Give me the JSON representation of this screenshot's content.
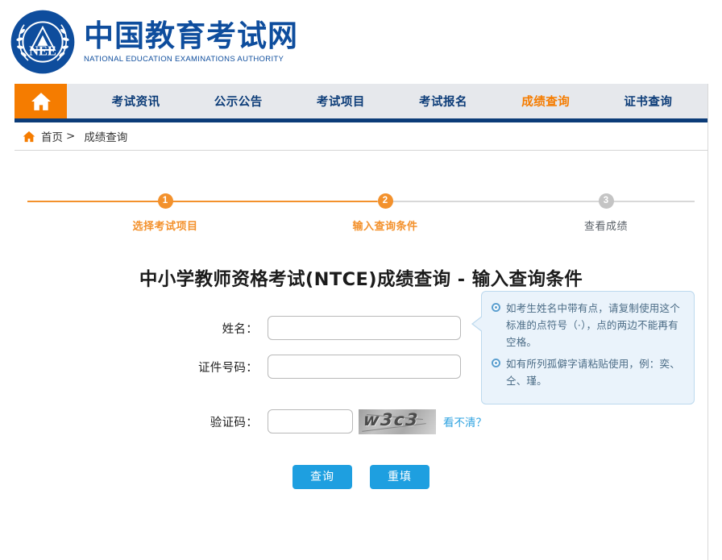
{
  "site": {
    "logo_cn": "中国教育考试网",
    "logo_en": "NATIONAL EDUCATION EXAMINATIONS AUTHORITY",
    "logo_initials": "NEE",
    "brand_blue": "#0e4d9d",
    "accent_orange": "#f57c00",
    "nav_bar_blue": "#0c3c78"
  },
  "nav": {
    "home_icon": "home-icon",
    "items": [
      {
        "label": "考试资讯",
        "active": false
      },
      {
        "label": "公示公告",
        "active": false
      },
      {
        "label": "考试项目",
        "active": false
      },
      {
        "label": "考试报名",
        "active": false
      },
      {
        "label": "成绩查询",
        "active": true
      },
      {
        "label": "证书查询",
        "active": false
      }
    ]
  },
  "breadcrumb": {
    "icon": "home-icon",
    "home": "首页",
    "separator": ">",
    "current": "成绩查询"
  },
  "steps": [
    {
      "number": "1",
      "label": "选择考试项目",
      "state": "done"
    },
    {
      "number": "2",
      "label": "输入查询条件",
      "state": "active"
    },
    {
      "number": "3",
      "label": "查看成绩",
      "state": "pending"
    }
  ],
  "form": {
    "title": "中小学教师资格考试(NTCE)成绩查询 - 输入查询条件",
    "fields": [
      {
        "label": "姓名：",
        "value": "",
        "placeholder": "",
        "name": "name-field"
      },
      {
        "label": "证件号码：",
        "value": "",
        "placeholder": "",
        "name": "id-number-field"
      },
      {
        "label": "验证码：",
        "value": "",
        "placeholder": "",
        "name": "captcha-field"
      }
    ],
    "captcha": {
      "text": "w3c3",
      "refresh_label": "看不清？",
      "refresh_color": "#2da2e0"
    },
    "buttons": [
      {
        "label": "查询",
        "name": "submit-button"
      },
      {
        "label": "重填",
        "name": "reset-button"
      }
    ],
    "button_color": "#1e9fe0"
  },
  "hint": {
    "items": [
      "如考生姓名中带有点，请复制使用这个标准的点符号（·），点的两边不能再有空格。",
      "如有所列孤僻字请粘贴使用，例：奕、仝、瑾。"
    ],
    "background": "#eaf3fb",
    "border": "#bcd9ee",
    "text_color": "#4a6b85"
  }
}
